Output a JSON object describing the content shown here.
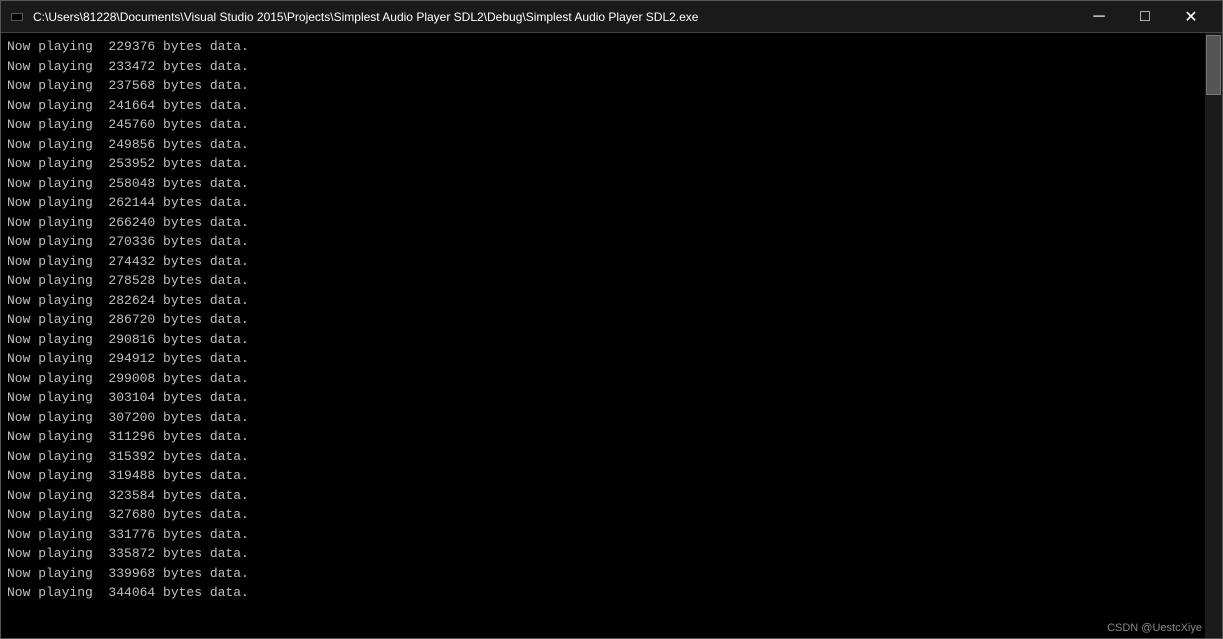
{
  "titleBar": {
    "title": "C:\\Users\\81228\\Documents\\Visual Studio 2015\\Projects\\Simplest Audio Player SDL2\\Debug\\Simplest Audio Player SDL2.exe",
    "minimizeLabel": "─",
    "maximizeLabel": "□",
    "closeLabel": "✕"
  },
  "console": {
    "lines": [
      "Now playing  229376 bytes data.",
      "Now playing  233472 bytes data.",
      "Now playing  237568 bytes data.",
      "Now playing  241664 bytes data.",
      "Now playing  245760 bytes data.",
      "Now playing  249856 bytes data.",
      "Now playing  253952 bytes data.",
      "Now playing  258048 bytes data.",
      "Now playing  262144 bytes data.",
      "Now playing  266240 bytes data.",
      "Now playing  270336 bytes data.",
      "Now playing  274432 bytes data.",
      "Now playing  278528 bytes data.",
      "Now playing  282624 bytes data.",
      "Now playing  286720 bytes data.",
      "Now playing  290816 bytes data.",
      "Now playing  294912 bytes data.",
      "Now playing  299008 bytes data.",
      "Now playing  303104 bytes data.",
      "Now playing  307200 bytes data.",
      "Now playing  311296 bytes data.",
      "Now playing  315392 bytes data.",
      "Now playing  319488 bytes data.",
      "Now playing  323584 bytes data.",
      "Now playing  327680 bytes data.",
      "Now playing  331776 bytes data.",
      "Now playing  335872 bytes data.",
      "Now playing  339968 bytes data.",
      "Now playing  344064 bytes data."
    ]
  },
  "watermark": {
    "text": "CSDN @UestcXiye"
  }
}
